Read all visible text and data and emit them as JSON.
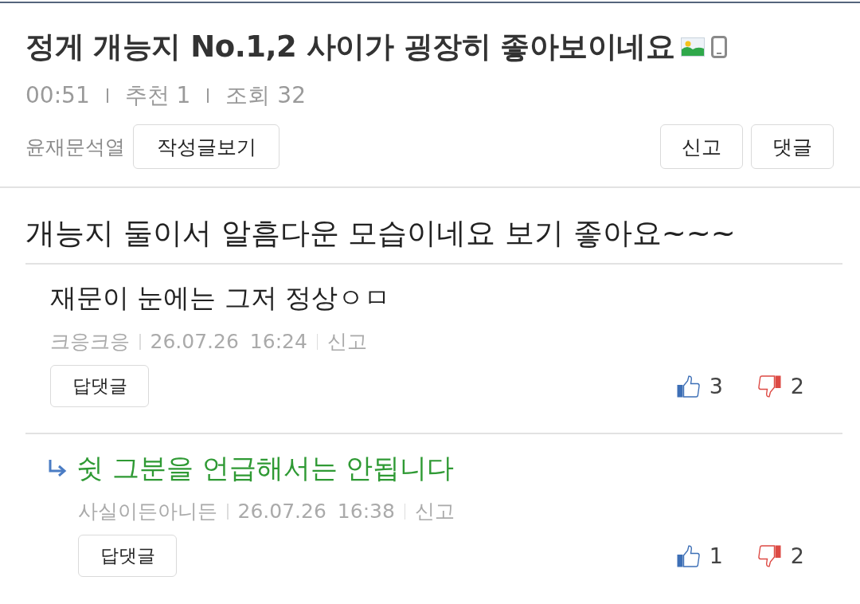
{
  "post": {
    "title": "정게 개능지 No.1,2 사이가 굉장히 좋아보이네요",
    "has_image": true,
    "mobile": true,
    "stats": [
      "00:51",
      "추천 1",
      "조회 32"
    ],
    "author": "윤재문석열",
    "author_posts_button": "작성글보기",
    "actions": [
      "신고",
      "댓글"
    ],
    "body": "개능지 둘이서 알흠다운 모습이네요 보기 좋아요~~~"
  },
  "comments": [
    {
      "kind": "comment",
      "text": "재문이 눈에는 그저 정상ㅇㅁ",
      "author": "크응크응",
      "date": "26.07.26",
      "time": "16:24",
      "report": "신고",
      "reply_button": "답댓글",
      "likes": "3",
      "dislikes": "2"
    },
    {
      "kind": "reply",
      "text": "쉿 그분을 언급해서는 안됩니다",
      "author": "사실이든아니든",
      "date": "26.07.26",
      "time": "16:38",
      "report": "신고",
      "reply_button": "답댓글",
      "likes": "1",
      "dislikes": "2"
    }
  ]
}
